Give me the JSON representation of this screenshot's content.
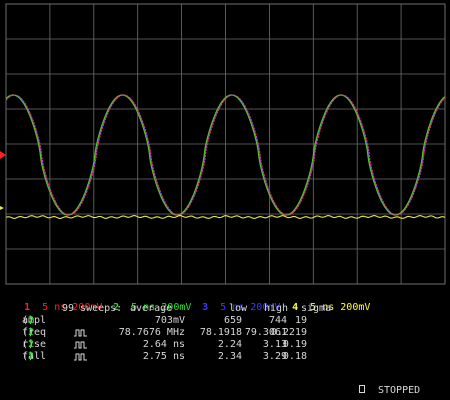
{
  "channels": [
    {
      "num": "1",
      "text": "5 ns 200mV",
      "color": "#ff1f1f"
    },
    {
      "num": "2",
      "text": "5 ns 200mV",
      "color": "#25e025"
    },
    {
      "num": "3",
      "text": "5 ns 200mV",
      "color": "#3a3aff"
    },
    {
      "num": "4",
      "text": "5 ns 200mV",
      "color": "#ffff33"
    }
  ],
  "stats": {
    "sweeps_label": "99 sweeps:",
    "headers": {
      "average": "average",
      "low": "low",
      "high": "high",
      "sigma": "sigma"
    },
    "rows": [
      {
        "name": "ampl",
        "ch": "2",
        "pulse": false,
        "average": "703mV",
        "low": "659",
        "high": "744",
        "sigma": "19"
      },
      {
        "name": "freq",
        "ch": "2",
        "pulse": true,
        "average": "78.7676 MHz",
        "low": "78.1918",
        "high": "79.3061",
        "sigma": "0.2219"
      },
      {
        "name": "rise",
        "ch": "2",
        "pulse": true,
        "average": "2.64 ns",
        "low": "2.24",
        "high": "3.13",
        "sigma": "0.19"
      },
      {
        "name": "fall",
        "ch": "2",
        "pulse": true,
        "average": "2.75 ns",
        "low": "2.34",
        "high": "3.29",
        "sigma": "0.18"
      }
    ]
  },
  "status": {
    "text": "STOPPED"
  },
  "colors": {
    "grid": "#6e6e6e",
    "trace_red": "#e03a6a",
    "trace_green": "#5cbf2a",
    "trace_yellow": "#e8e840",
    "marker": "#ff2020"
  }
}
